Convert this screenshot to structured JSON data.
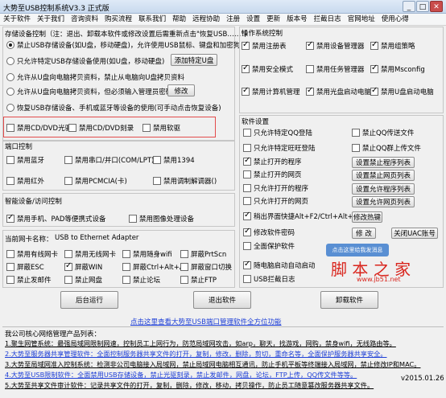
{
  "window": {
    "title": "大势至USB控制系统V3.3 正式版",
    "minimize": "_",
    "maximize": "□",
    "close": "✕"
  },
  "menu": [
    "关于软件",
    "关于我们",
    "咨询资料",
    "购买流程",
    "联系我们",
    "帮助",
    "远程协助",
    "注册",
    "设置",
    "更新",
    "版本号",
    "拦截日志",
    "官网地址",
    "使用心得"
  ],
  "storage": {
    "title": "存储设备控制（注：退出、卸载本软件或修改设置后需重新点击\"恢复USB……\")",
    "opt1": "禁止USB存储设备(如U盘，移动硬盘)，允许使用USB鼠标、键盘和加密狗",
    "opt2": "只允许特定USB存储设备使用(如U盘，移动硬盘)",
    "opt2_btn": "添加特定U盘",
    "opt3": "允许从U盘向电脑拷贝资料，禁止从电脑向U盘拷贝资料",
    "opt4": "允许从U盘向电脑拷贝资料，但必须输入管理员密码",
    "opt4_btn": "修改",
    "opt5": "恢复USB存储设备、手机或蓝牙等设备的使用(可手动点击恢复设备)"
  },
  "cd": {
    "cd_rom": "禁用CD/DVD光驱",
    "cd_burn": "禁用CD/DVD刻录",
    "floppy": "禁用软驱"
  },
  "port": {
    "title": "端口控制",
    "bluetooth": "禁用蓝牙",
    "serial": "禁用串口/并口(COM/LPT)",
    "p1394": "禁用1394",
    "infrared": "禁用红外",
    "pcmcia": "禁用PCMCIA(卡)",
    "modem": "禁用调制解调器()"
  },
  "smart": {
    "title": "智能设备/访问控制",
    "phone": "禁用手机、PAD等便携式设备",
    "imaging": "禁用图像处理设备"
  },
  "nic": {
    "label": "当前网卡名称：",
    "value": "USB to Ethernet Adapter"
  },
  "misc": [
    [
      "禁用有线网卡",
      "禁用无线网卡",
      "禁用随身wifi",
      "屏蔽PrtScn"
    ],
    [
      "屏蔽ESC",
      "屏蔽WIN",
      "屏蔽Ctrl+Alt+A",
      "屏蔽窗口切换"
    ],
    [
      "禁止发邮件",
      "禁止网盘",
      "禁止论坛",
      "禁止FTP"
    ]
  ],
  "os": {
    "title": "操作系统控制",
    "items": [
      [
        "禁用注册表",
        "禁用设备管理器",
        "禁用组策略"
      ],
      [
        "禁用安全模式",
        "禁用任务管理器",
        "禁用Msconfig"
      ],
      [
        "禁用计算机管理",
        "禁用光盘启动电脑",
        "禁用U盘启动电脑"
      ]
    ]
  },
  "software": {
    "title": "软件设置",
    "items": [
      "只允许特定QQ登陆",
      "只允许特定旺旺登陆",
      "禁止打开的程序",
      "禁止打开的网页",
      "只允许打开的程序",
      "只允许打开的网页",
      "稍出界面快捷Alt+F2/Ctrl+Alt+1",
      "修改软件密码",
      "全面保护软件",
      "随电脑启动自动启动",
      "USB拦截日志"
    ],
    "right": [
      "禁止QQ传送文件",
      "禁止QQ群上传文件"
    ],
    "btn_prog": "设置禁止程序列表",
    "btn_web": "设置禁止网页列表",
    "btn_allow_prog": "设置允许程序列表",
    "btn_allow_web": "设置允许网页列表",
    "hotkey_btn": "修改热键",
    "modify_btn": "修 改",
    "close_uac": "关闭UAC账号"
  },
  "actions": {
    "run_bg": "后台运行",
    "exit": "退出软件",
    "uninstall": "卸载软件"
  },
  "promo": {
    "link": "点击这里查看大势至USB端口管理软件全方位功能",
    "title": "我公司核心网络管理产品列表：",
    "lines": [
      "1.聚生网管系统：最强局域网限制网速，控制员工上网行为，防范局域网攻击，如arp，聊天，找游戏，网购，禁身wifi，无线路由等。",
      "2.大势至服务器共享管理软件：全面控制服务器共享文件的打开，复制，修改，删除，剪切，重命名等，全面保护服务器共享安全。",
      "3.大势至局域网准入控制系统：检测非公司电脑接入局域网，禁止局域网电脑相互通讯，防止手机平板等终端接入局域网，禁止修改IP和MAC。",
      "4.大势至USB限制软件：全面禁用USB存储设备，禁止光驱刻录，禁止发邮件，网盘，论坛，FTP上传，QQ传文件等等。",
      "5.大势至共享文件审计软件：记录共享文件的打开，复制，删除，修改，移动，拷贝操作，防止员工随意篡改服务器共享文件。"
    ],
    "date": "v2015.01.26"
  },
  "watermark": {
    "brand": "脚 本 之 家",
    "url": "www.jb51.net",
    "badge": "点击这里给我发消息"
  }
}
